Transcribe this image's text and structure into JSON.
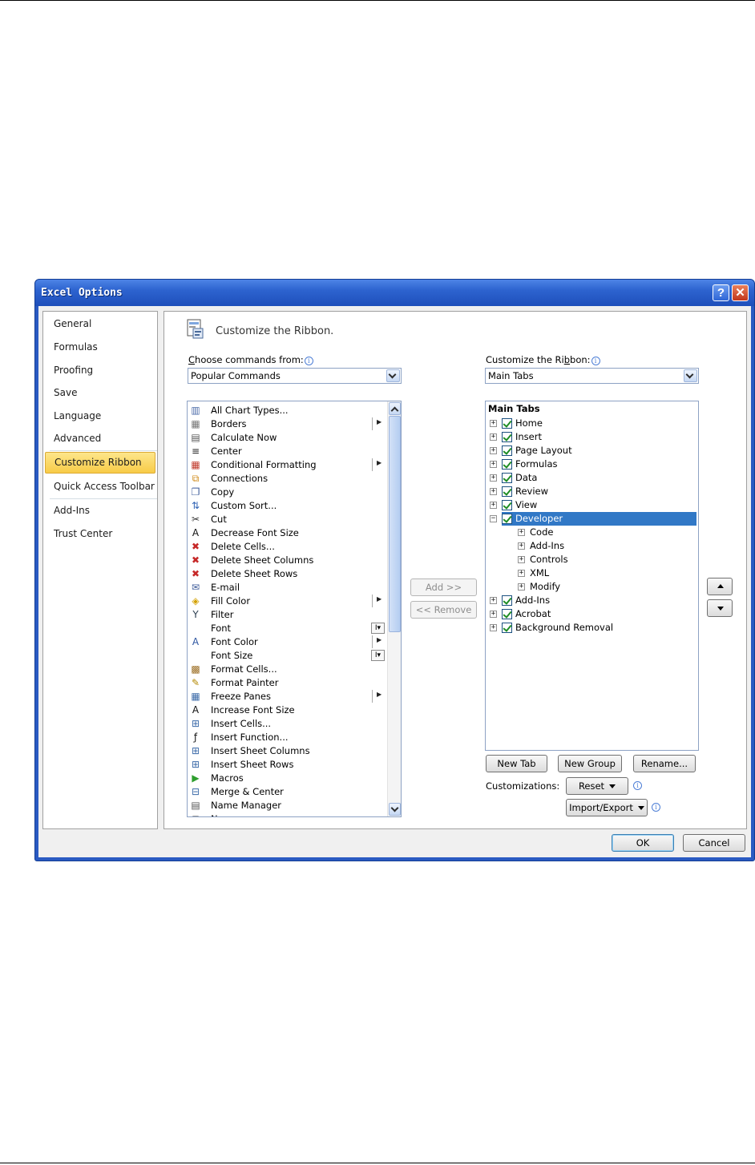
{
  "dialog": {
    "title": "Excel Options",
    "help_icon": "help-icon",
    "close_icon": "close-icon"
  },
  "nav": {
    "items": [
      {
        "label": "General"
      },
      {
        "label": "Formulas"
      },
      {
        "label": "Proofing"
      },
      {
        "label": "Save"
      },
      {
        "label": "Language"
      },
      {
        "label": "Advanced"
      },
      {
        "label": "Customize Ribbon",
        "selected": true
      },
      {
        "label": "Quick Access Toolbar"
      },
      {
        "label": "Add-Ins"
      },
      {
        "label": "Trust Center"
      }
    ]
  },
  "content": {
    "header": "Customize the Ribbon.",
    "choose_label_prefix": "",
    "choose_label_ul": "C",
    "choose_label_rest": "hoose commands from:",
    "choose_value": "Popular Commands",
    "ribbon_label_pre": "Customize the Ri",
    "ribbon_label_ul": "b",
    "ribbon_label_post": "bon:",
    "ribbon_value": "Main Tabs",
    "commands": [
      {
        "label": "All Chart Types...",
        "icon": "chart-icon"
      },
      {
        "label": "Borders",
        "icon": "borders-icon",
        "submenu": true
      },
      {
        "label": "Calculate Now",
        "icon": "calculator-icon"
      },
      {
        "label": "Center",
        "icon": "align-center-icon"
      },
      {
        "label": "Conditional Formatting",
        "icon": "conditional-formatting-icon",
        "submenu": true
      },
      {
        "label": "Connections",
        "icon": "connections-icon"
      },
      {
        "label": "Copy",
        "icon": "copy-icon"
      },
      {
        "label": "Custom Sort...",
        "icon": "sort-icon"
      },
      {
        "label": "Cut",
        "icon": "scissors-icon"
      },
      {
        "label": "Decrease Font Size",
        "icon": "decrease-font-icon"
      },
      {
        "label": "Delete Cells...",
        "icon": "delete-cells-icon"
      },
      {
        "label": "Delete Sheet Columns",
        "icon": "delete-columns-icon"
      },
      {
        "label": "Delete Sheet Rows",
        "icon": "delete-rows-icon"
      },
      {
        "label": "E-mail",
        "icon": "email-icon"
      },
      {
        "label": "Fill Color",
        "icon": "fill-color-icon",
        "submenu": true
      },
      {
        "label": "Filter",
        "icon": "filter-icon"
      },
      {
        "label": "Font",
        "icon": "none",
        "sizebox": true
      },
      {
        "label": "Font Color",
        "icon": "font-color-icon",
        "submenu": true
      },
      {
        "label": "Font Size",
        "icon": "none",
        "sizebox": true
      },
      {
        "label": "Format Cells...",
        "icon": "format-cells-icon"
      },
      {
        "label": "Format Painter",
        "icon": "format-painter-icon"
      },
      {
        "label": "Freeze Panes",
        "icon": "freeze-panes-icon",
        "submenu": true
      },
      {
        "label": "Increase Font Size",
        "icon": "increase-font-icon"
      },
      {
        "label": "Insert Cells...",
        "icon": "insert-cells-icon"
      },
      {
        "label": "Insert Function...",
        "icon": "function-icon"
      },
      {
        "label": "Insert Sheet Columns",
        "icon": "insert-columns-icon"
      },
      {
        "label": "Insert Sheet Rows",
        "icon": "insert-rows-icon"
      },
      {
        "label": "Macros",
        "icon": "macro-play-icon"
      },
      {
        "label": "Merge & Center",
        "icon": "merge-center-icon"
      },
      {
        "label": "Name Manager",
        "icon": "name-manager-icon"
      },
      {
        "label": "New",
        "icon": "new-icon"
      }
    ],
    "add_button": "Add >>",
    "remove_button": "<< Remove",
    "tree_header": "Main Tabs",
    "tree": [
      {
        "label": "Home",
        "level": 0,
        "expander": "+",
        "checked": true
      },
      {
        "label": "Insert",
        "level": 0,
        "expander": "+",
        "checked": true
      },
      {
        "label": "Page Layout",
        "level": 0,
        "expander": "+",
        "checked": true
      },
      {
        "label": "Formulas",
        "level": 0,
        "expander": "+",
        "checked": true
      },
      {
        "label": "Data",
        "level": 0,
        "expander": "+",
        "checked": true
      },
      {
        "label": "Review",
        "level": 0,
        "expander": "+",
        "checked": true
      },
      {
        "label": "View",
        "level": 0,
        "expander": "+",
        "checked": true
      },
      {
        "label": "Developer",
        "level": 0,
        "expander": "-",
        "checked": true,
        "selected": true
      },
      {
        "label": "Code",
        "level": 1,
        "expander": "+"
      },
      {
        "label": "Add-Ins",
        "level": 1,
        "expander": "+"
      },
      {
        "label": "Controls",
        "level": 1,
        "expander": "+"
      },
      {
        "label": "XML",
        "level": 1,
        "expander": "+"
      },
      {
        "label": "Modify",
        "level": 1,
        "expander": "+"
      },
      {
        "label": "Add-Ins",
        "level": 0,
        "expander": "+",
        "checked": true
      },
      {
        "label": "Acrobat",
        "level": 0,
        "expander": "+",
        "checked": true
      },
      {
        "label": "Background Removal",
        "level": 0,
        "expander": "+",
        "checked": true
      }
    ],
    "new_tab": "New Tab",
    "new_group": "New Group",
    "rename": "Rename...",
    "customizations_label": "Customizations:",
    "reset": "Reset",
    "import_export": "Import/Export"
  },
  "footer": {
    "ok": "OK",
    "cancel": "Cancel"
  }
}
